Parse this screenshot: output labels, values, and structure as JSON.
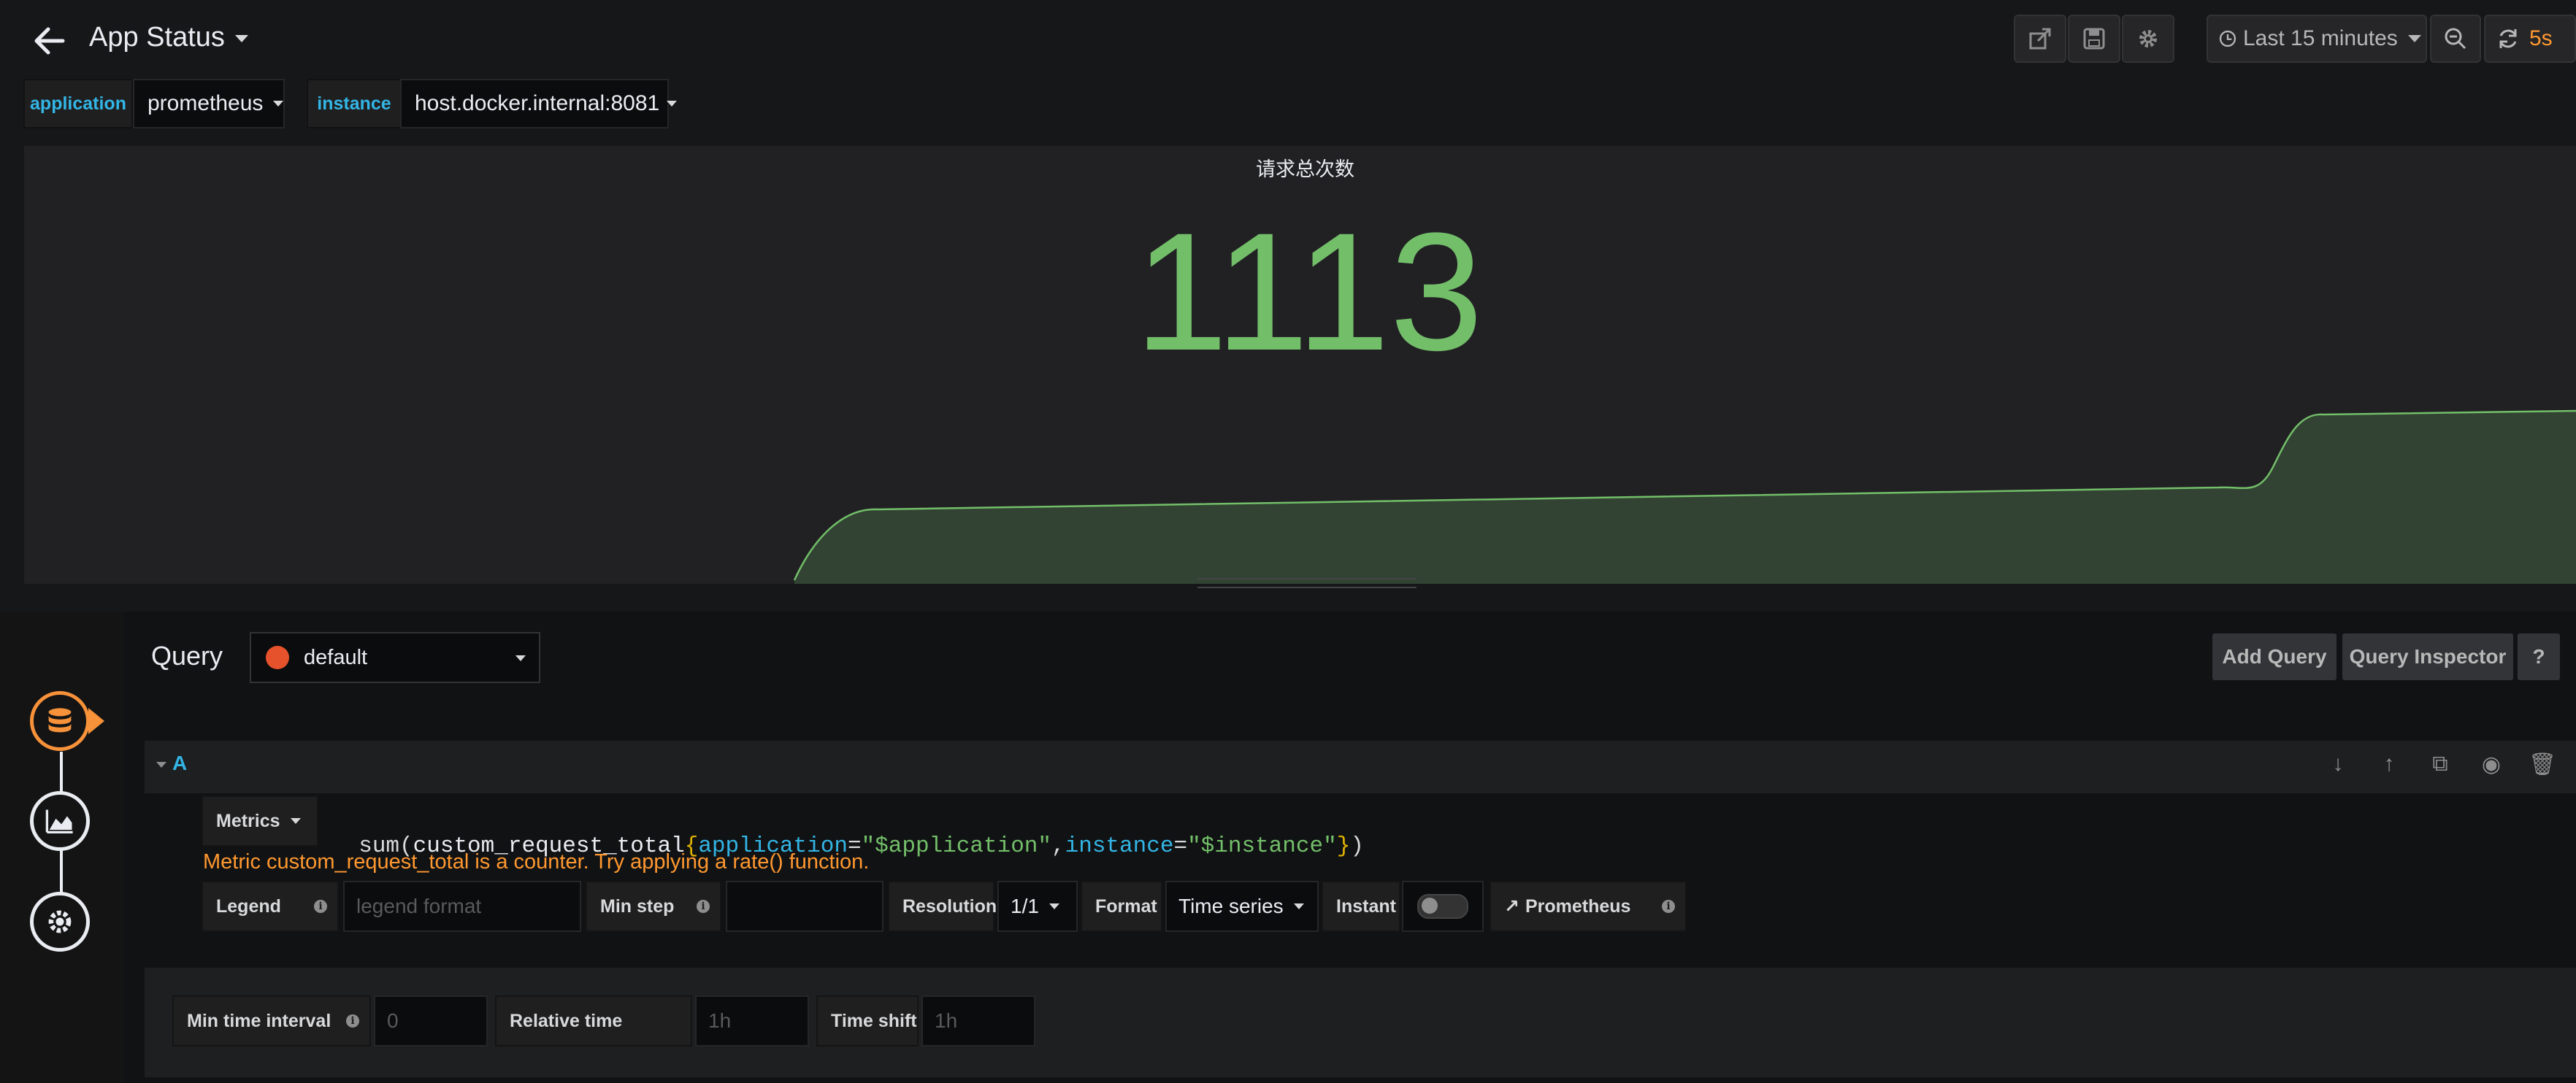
{
  "navbar": {
    "title": "App Status",
    "time_range": "Last 15 minutes",
    "refresh_interval": "5s"
  },
  "variables": [
    {
      "label": "application",
      "value": "prometheus"
    },
    {
      "label": "instance",
      "value": "host.docker.internal:8081"
    }
  ],
  "panel": {
    "title": "请求总次数",
    "value": "1113",
    "sparkline_color": "#73bf69"
  },
  "query_editor": {
    "label": "Query",
    "datasource": "default",
    "add_query": "Add Query",
    "query_inspector": "Query Inspector",
    "help": "?",
    "row": {
      "ref_id": "A",
      "metrics_label": "Metrics",
      "expr": {
        "fn": "sum",
        "metric": "custom_request_total",
        "k1": "application",
        "v1": "\"$application\"",
        "k2": "instance",
        "v2": "\"$instance\""
      },
      "warning": "Metric custom_request_total is a counter. Try applying a rate() function.",
      "legend_label": "Legend",
      "legend_placeholder": "legend format",
      "min_step_label": "Min step",
      "min_step_value": "",
      "resolution_label": "Resolution",
      "resolution_value": "1/1",
      "format_label": "Format",
      "format_value": "Time series",
      "instant_label": "Instant",
      "prometheus_link": "Prometheus"
    },
    "options": {
      "min_interval_label": "Min time interval",
      "min_interval_placeholder": "0",
      "relative_time_label": "Relative time",
      "relative_time_placeholder": "1h",
      "time_shift_label": "Time shift",
      "time_shift_placeholder": "1h"
    }
  },
  "colors": {
    "accent_blue": "#33b5e5",
    "value_green": "#73bf69",
    "warning_orange": "#ff9830",
    "rail_active": "#f7923a"
  }
}
